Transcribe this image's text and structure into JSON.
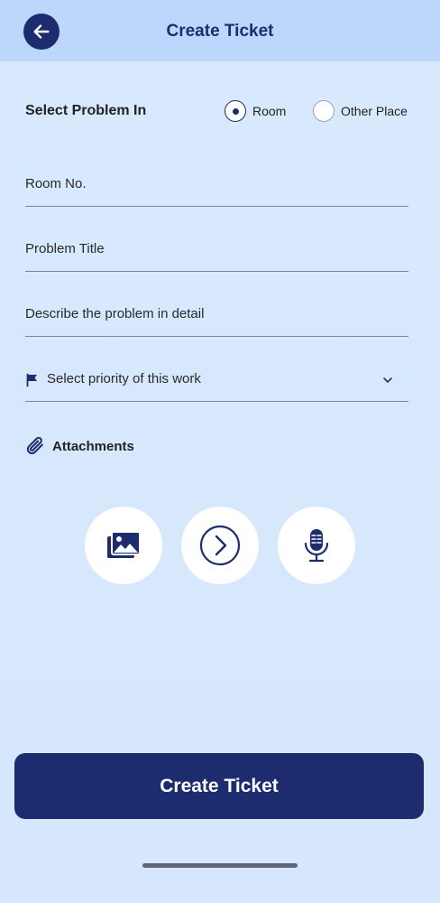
{
  "header": {
    "title": "Create Ticket"
  },
  "problem_location": {
    "label": "Select Problem In",
    "options": [
      {
        "label": "Room",
        "selected": true
      },
      {
        "label": "Other Place",
        "selected": false
      }
    ]
  },
  "form": {
    "room_no_placeholder": "Room No.",
    "problem_title_placeholder": "Problem Title",
    "description_placeholder": "Describe the problem in detail",
    "priority_placeholder": "Select priority of this work"
  },
  "attachments": {
    "label": "Attachments",
    "buttons": [
      "image-gallery-icon",
      "chevron-right-circle-icon",
      "microphone-icon"
    ]
  },
  "submit": {
    "label": "Create Ticket"
  },
  "colors": {
    "primary": "#1c2c6e",
    "header_bg": "#bcd7fb",
    "page_bg": "#d9e9fd"
  }
}
